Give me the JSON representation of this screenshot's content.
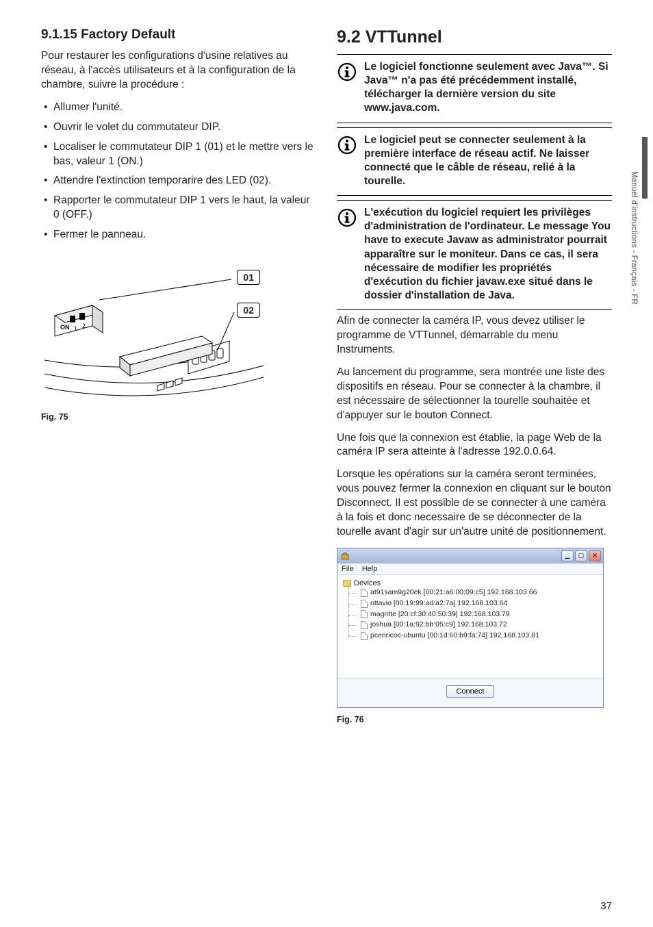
{
  "leftColumn": {
    "heading": "9.1.15 Factory Default",
    "intro": "Pour restaurer les configurations d'usine relatives au réseau, à l'accès utilisateurs et à la configuration de la chambre, suivre la procédure :",
    "steps": [
      "Allumer l'unité.",
      "Ouvrir le volet du commutateur DIP.",
      "Localiser le commutateur DIP 1 (01) et le mettre vers le bas, valeur 1 (ON.)",
      "Attendre l'extinction temporarire des LED (02).",
      "Rapporter le commutateur DIP 1 vers le haut, la valeur 0 (OFF.)",
      "Fermer le panneau."
    ],
    "callouts": {
      "c1": "01",
      "c2": "02"
    },
    "figCaption": "Fig. 75"
  },
  "rightColumn": {
    "heading": "9.2 VTTunnel",
    "note1": "Le logiciel fonctionne seulement avec Java™. Si Java™ n'a pas été précédemment installé, télécharger la dernière version du site www.java.com.",
    "note2": "Le logiciel peut se connecter seulement à la première interface de réseau actif. Ne laisser connecté que le câble de réseau, relié à la tourelle.",
    "note3": "L'exécution du logiciel requiert les privilèges d'administration de l'ordinateur. Le message You have to execute Javaw as administrator pourrait apparaître sur le moniteur. Dans ce cas, il sera nécessaire de modifier les propriétés d'exécution du fichier javaw.exe situé dans le dossier d'installation de Java.",
    "para1": "Afin de connecter la caméra IP, vous devez utiliser le programme de VTTunnel, démarrable du menu Instruments.",
    "para2": "Au lancement du programme, sera montrée une liste des dispositifs en réseau. Pour se connecter à la chambre, il est nécessaire de sélectionner la tourelle souhaitée et d'appuyer sur le bouton Connect.",
    "para3": "Une fois que la connexion est établie, la page Web de la caméra IP sera atteinte à l'adresse 192.0.0.64.",
    "para4": "Lorsque les opérations sur la caméra seront terminées, vous pouvez fermer la connexion en cliquant sur le bouton Disconnect. Il est possible de se connecter à une caméra à la fois et donc necessaire de se déconnecter de la tourelle avant d'agir sur un'autre unité de positionnement.",
    "figCaption": "Fig. 76"
  },
  "vtWindow": {
    "menu": {
      "file": "File",
      "help": "Help"
    },
    "root": "Devices",
    "items": [
      "at91sam9g20ek [00:21:a6:00:09:c5] 192.168.103.66",
      "ottavio [00:19:99:ad:a2:7a] 192.168.103.64",
      "magritte [20:cf:30:40:50:39] 192.168.103.79",
      "joshua [00:1a:92:bb:05:c9] 192.168.103.72",
      "pcenricoc-ubuntu [00:1d:60:b9:fa:74] 192.168.103.81"
    ],
    "connect": "Connect"
  },
  "sideLabel": "Manuel d'instructions - Français - FR",
  "pageNumber": "37"
}
